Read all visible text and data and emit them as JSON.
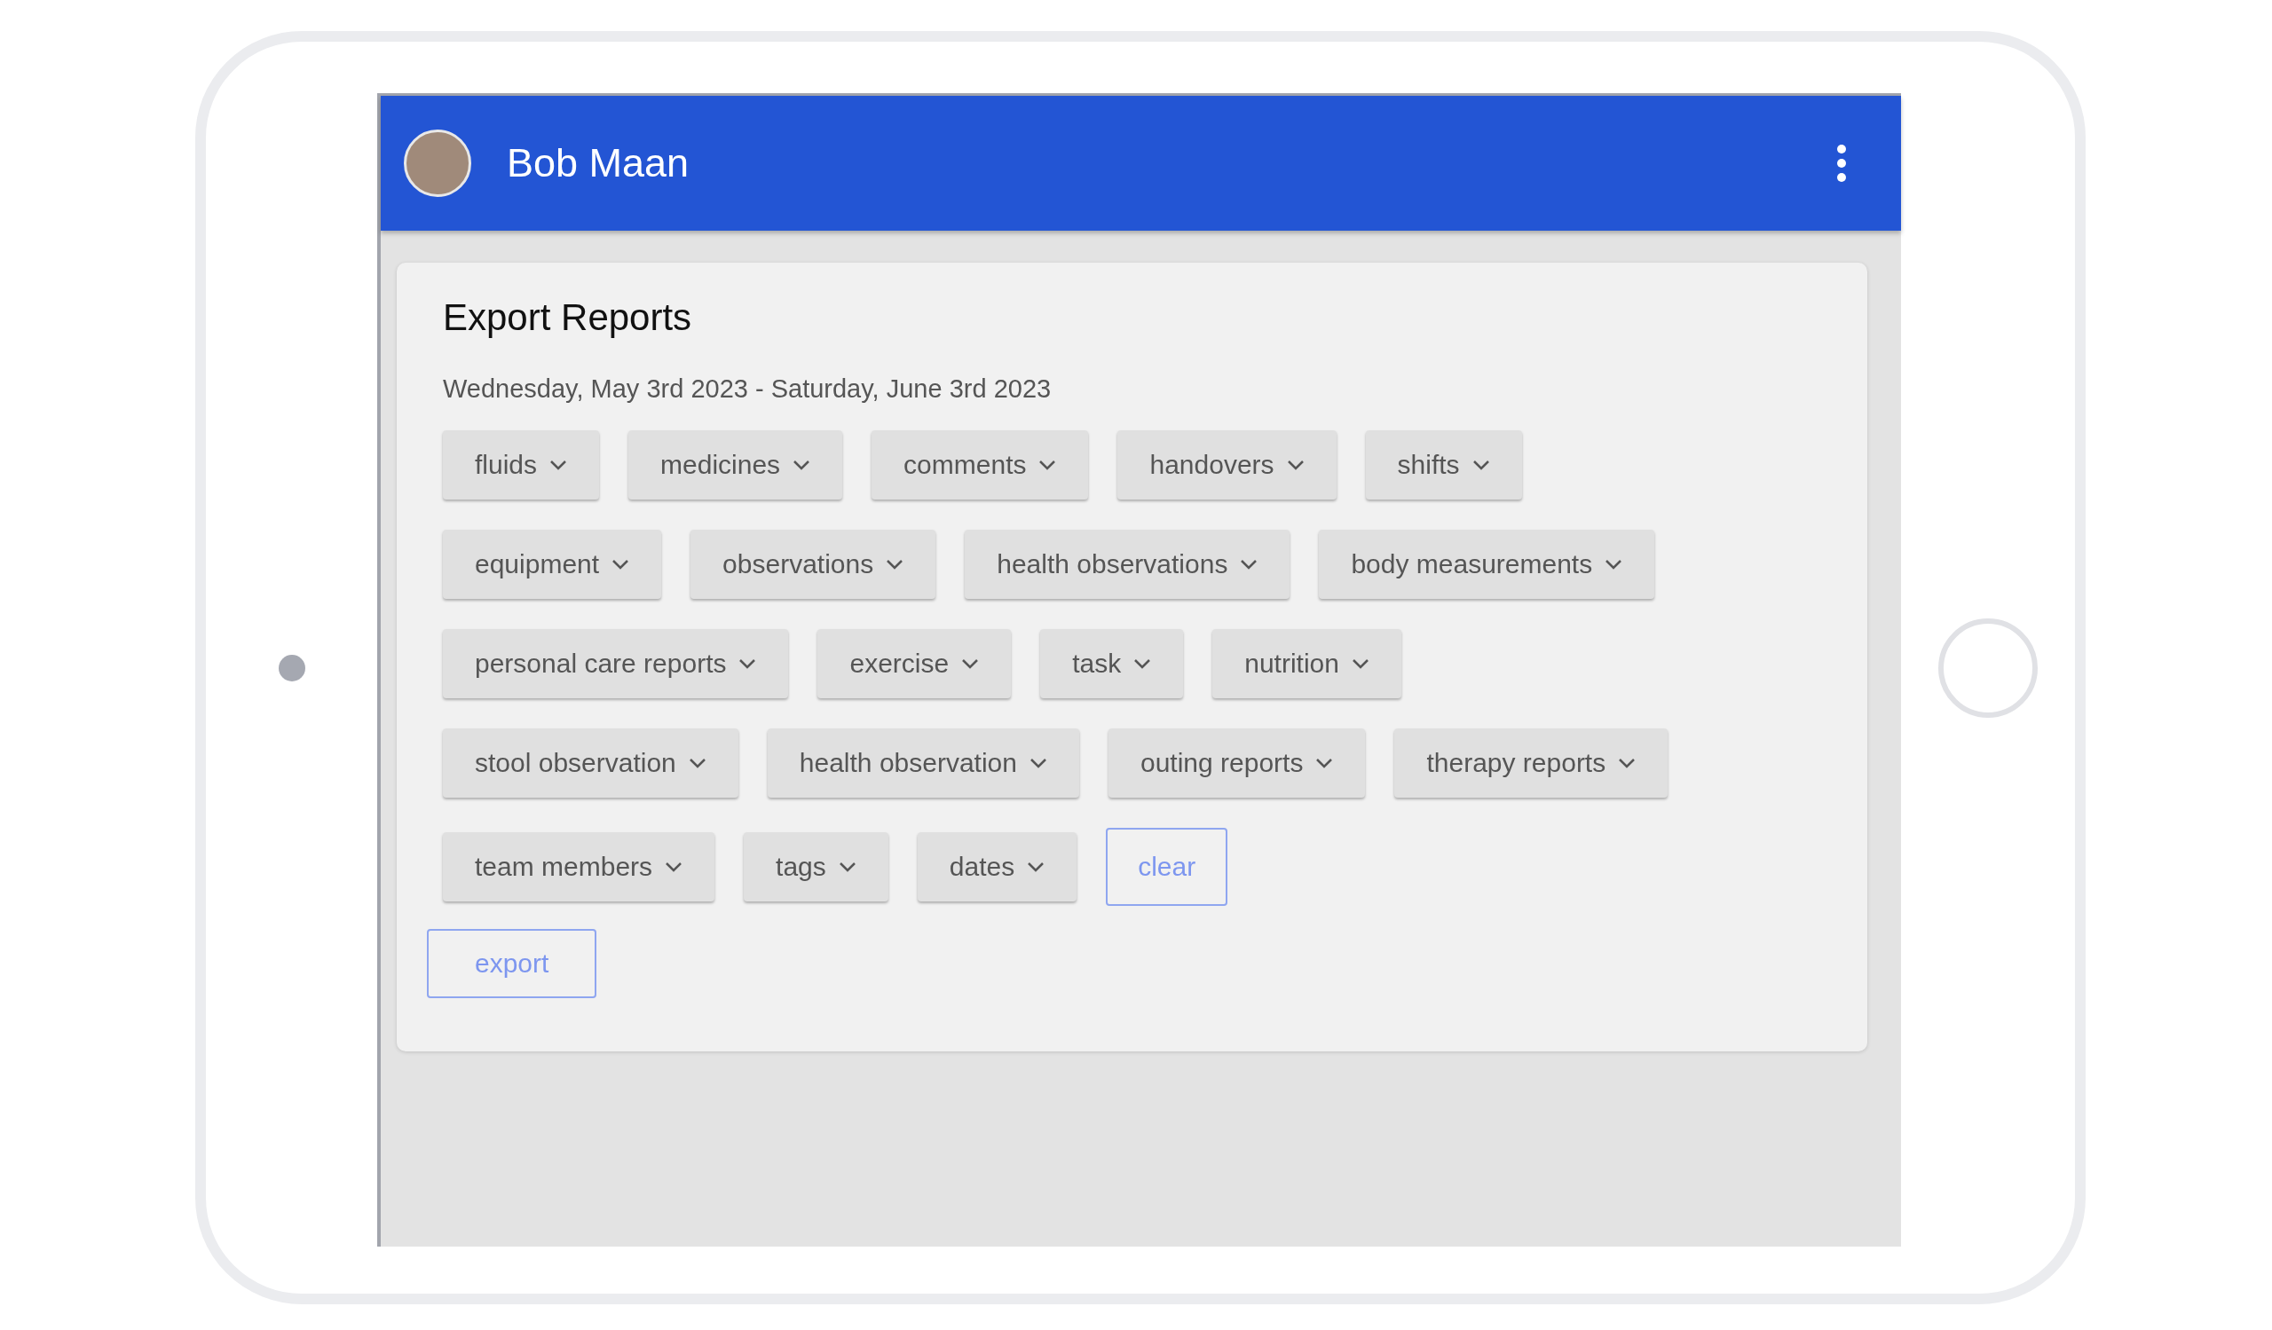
{
  "header": {
    "title": "Bob Maan"
  },
  "card": {
    "title": "Export Reports",
    "date_range": "Wednesday, May 3rd 2023 - Saturday, June 3rd 2023",
    "filter_rows": [
      {
        "filters": [
          {
            "label": "fluids"
          },
          {
            "label": "medicines"
          },
          {
            "label": "comments"
          },
          {
            "label": "handovers"
          },
          {
            "label": "shifts"
          }
        ]
      },
      {
        "filters": [
          {
            "label": "equipment"
          },
          {
            "label": "observations"
          },
          {
            "label": "health observations"
          },
          {
            "label": "body measurements"
          }
        ]
      },
      {
        "filters": [
          {
            "label": "personal care reports"
          },
          {
            "label": "exercise"
          },
          {
            "label": "task"
          },
          {
            "label": "nutrition"
          }
        ]
      },
      {
        "filters": [
          {
            "label": "stool observation"
          },
          {
            "label": "health observation"
          },
          {
            "label": "outing reports"
          },
          {
            "label": "therapy reports"
          }
        ]
      },
      {
        "filters": [
          {
            "label": "team members"
          },
          {
            "label": "tags"
          },
          {
            "label": "dates"
          }
        ]
      }
    ],
    "clear_button": {
      "label": "clear"
    },
    "export_button": {
      "label": "export"
    }
  }
}
